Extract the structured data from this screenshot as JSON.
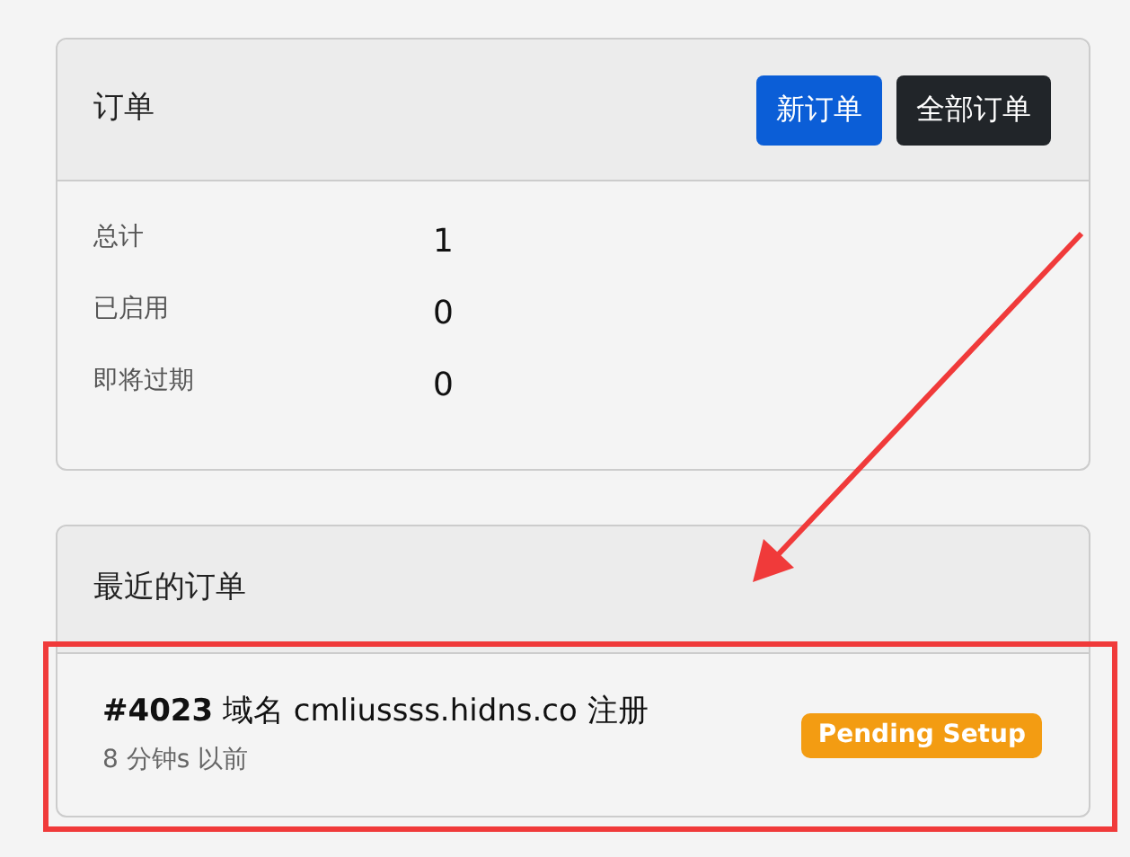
{
  "orders_card": {
    "title": "订单",
    "buttons": [
      {
        "label": "新订单",
        "kind": "primary"
      },
      {
        "label": "全部订单",
        "kind": "dark"
      }
    ],
    "stats": [
      {
        "label": "总计",
        "value": "1"
      },
      {
        "label": "已启用",
        "value": "0"
      },
      {
        "label": "即将过期",
        "value": "0"
      }
    ]
  },
  "recent_card": {
    "title": "最近的订单",
    "orders": [
      {
        "description": "**#4023** 域名 cmliussss.hidns.co 注册",
        "time": "8 分钟s 以前",
        "status": "Pending Setup"
      }
    ]
  }
}
